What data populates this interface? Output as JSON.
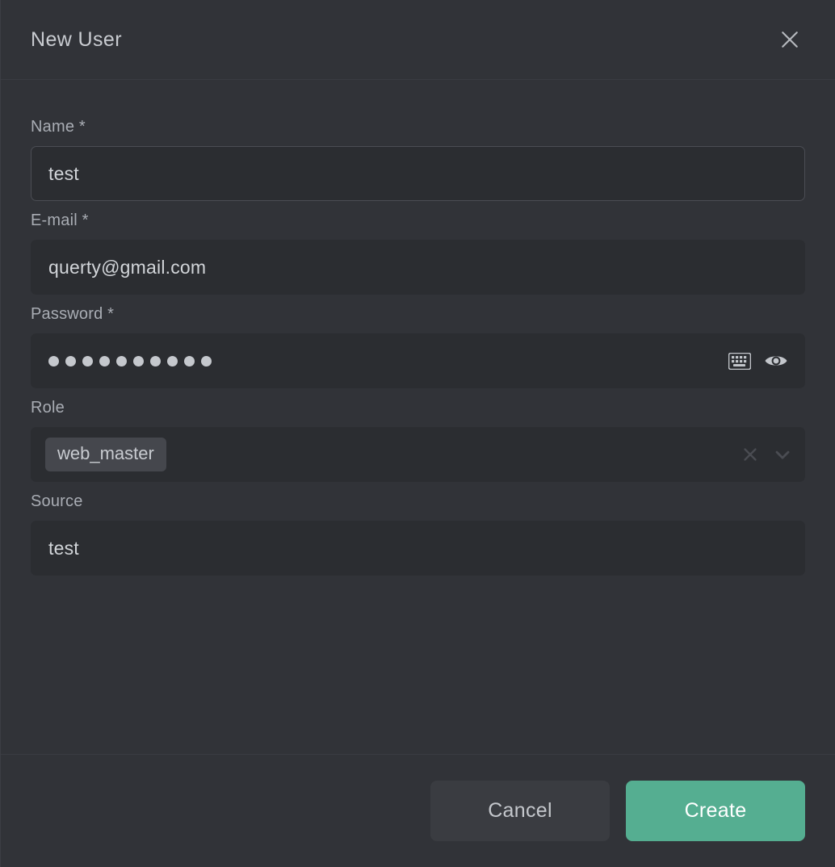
{
  "dialog": {
    "title": "New User",
    "close_icon": "close-icon"
  },
  "form": {
    "fields": [
      {
        "label": "Name *",
        "value": "test",
        "placeholder": ""
      },
      {
        "label": "E-mail *",
        "value": "querty@gmail.com",
        "placeholder": ""
      },
      {
        "label": "Password *",
        "masked_value": "●●●●●●●●●●",
        "dot_count": 10,
        "keyboard_icon": "keyboard-icon",
        "reveal_icon": "eye-icon"
      },
      {
        "label": "Role",
        "selected": "web_master",
        "clear_icon": "clear-icon",
        "dropdown_icon": "chevron-down-icon"
      },
      {
        "label": "Source",
        "value": "test",
        "placeholder": ""
      }
    ]
  },
  "footer": {
    "cancel_label": "Cancel",
    "create_label": "Create"
  },
  "colors": {
    "dialog_background": "#313338",
    "input_background": "#2b2d31",
    "accent_green": "#55ae91",
    "label_text": "#a9adb4",
    "value_text": "#d2d5d9",
    "chip_background": "#45474d",
    "divider": "#3a3c42"
  }
}
